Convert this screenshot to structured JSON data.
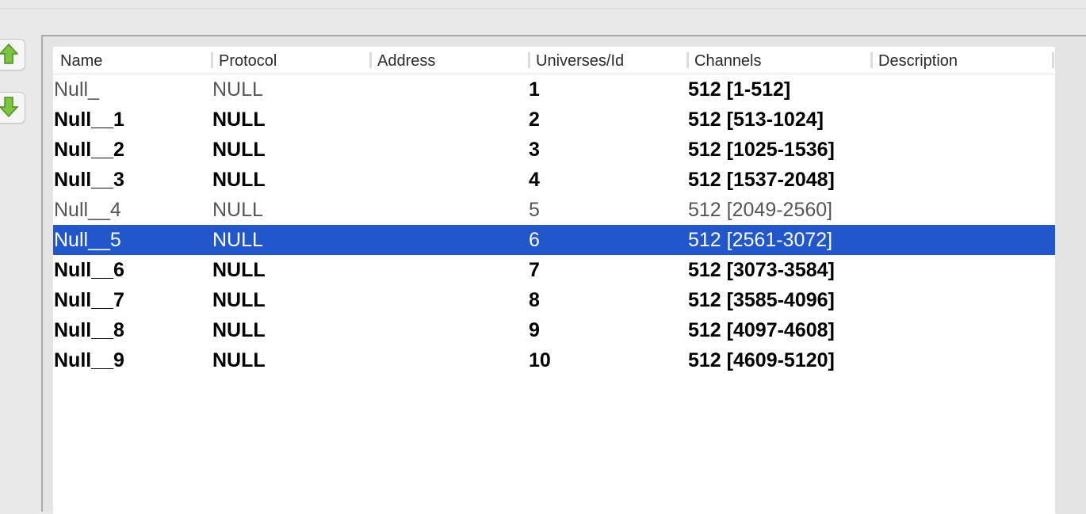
{
  "colors": {
    "selection": "#2157ca",
    "arrow_green": "#7cc441"
  },
  "buttons": {
    "move_up_icon": "arrow-up-icon",
    "move_down_icon": "arrow-down-icon"
  },
  "table": {
    "columns": [
      "Name",
      "Protocol",
      "Address",
      "Universes/Id",
      "Channels",
      "Description"
    ],
    "rows": [
      {
        "name": "Null_",
        "protocol": "NULL",
        "address": "",
        "universe": "1",
        "channels": "512 [1-512]",
        "description": ""
      },
      {
        "name": "Null__1",
        "protocol": "NULL",
        "address": "",
        "universe": "2",
        "channels": "512 [513-1024]",
        "description": ""
      },
      {
        "name": "Null__2",
        "protocol": "NULL",
        "address": "",
        "universe": "3",
        "channels": "512 [1025-1536]",
        "description": ""
      },
      {
        "name": "Null__3",
        "protocol": "NULL",
        "address": "",
        "universe": "4",
        "channels": "512 [1537-2048]",
        "description": ""
      },
      {
        "name": "Null__4",
        "protocol": "NULL",
        "address": "",
        "universe": "5",
        "channels": "512 [2049-2560]",
        "description": ""
      },
      {
        "name": "Null__5",
        "protocol": "NULL",
        "address": "",
        "universe": "6",
        "channels": "512 [2561-3072]",
        "description": ""
      },
      {
        "name": "Null__6",
        "protocol": "NULL",
        "address": "",
        "universe": "7",
        "channels": "512 [3073-3584]",
        "description": ""
      },
      {
        "name": "Null__7",
        "protocol": "NULL",
        "address": "",
        "universe": "8",
        "channels": "512 [3585-4096]",
        "description": ""
      },
      {
        "name": "Null__8",
        "protocol": "NULL",
        "address": "",
        "universe": "9",
        "channels": "512 [4097-4608]",
        "description": ""
      },
      {
        "name": "Null__9",
        "protocol": "NULL",
        "address": "",
        "universe": "10",
        "channels": "512 [4609-5120]",
        "description": ""
      }
    ]
  }
}
